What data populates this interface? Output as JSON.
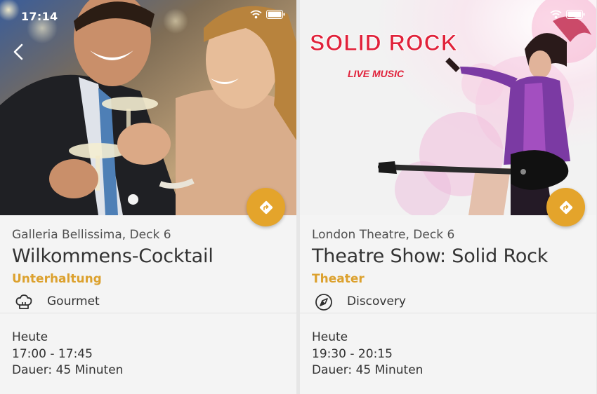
{
  "status_bar": {
    "time": "17:14"
  },
  "cards": [
    {
      "venue": "Galleria Bellissima, Deck 6",
      "title": "Wilkommens-Cocktail",
      "category": "Unterhaltung",
      "tag": {
        "label": "Gourmet",
        "icon": "chef-hat-icon"
      },
      "day": "Heute",
      "time_range": "17:00 - 17:45",
      "duration": "Dauer: 45 Minuten"
    },
    {
      "poster": {
        "headline": "SOLID ROCK",
        "subline": "LIVE MUSIC"
      },
      "venue": "London Theatre, Deck 6",
      "title": "Theatre Show: Solid Rock",
      "category": "Theater",
      "tag": {
        "label": "Discovery",
        "icon": "compass-icon"
      },
      "day": "Heute",
      "time_range": "19:30 - 20:15",
      "duration": "Dauer: 45 Minuten"
    }
  ],
  "colors": {
    "accent": "#dca12e",
    "fab": "#e4a42b",
    "poster_text": "#e0213a",
    "text_primary": "#333333",
    "text_secondary": "#505050"
  }
}
